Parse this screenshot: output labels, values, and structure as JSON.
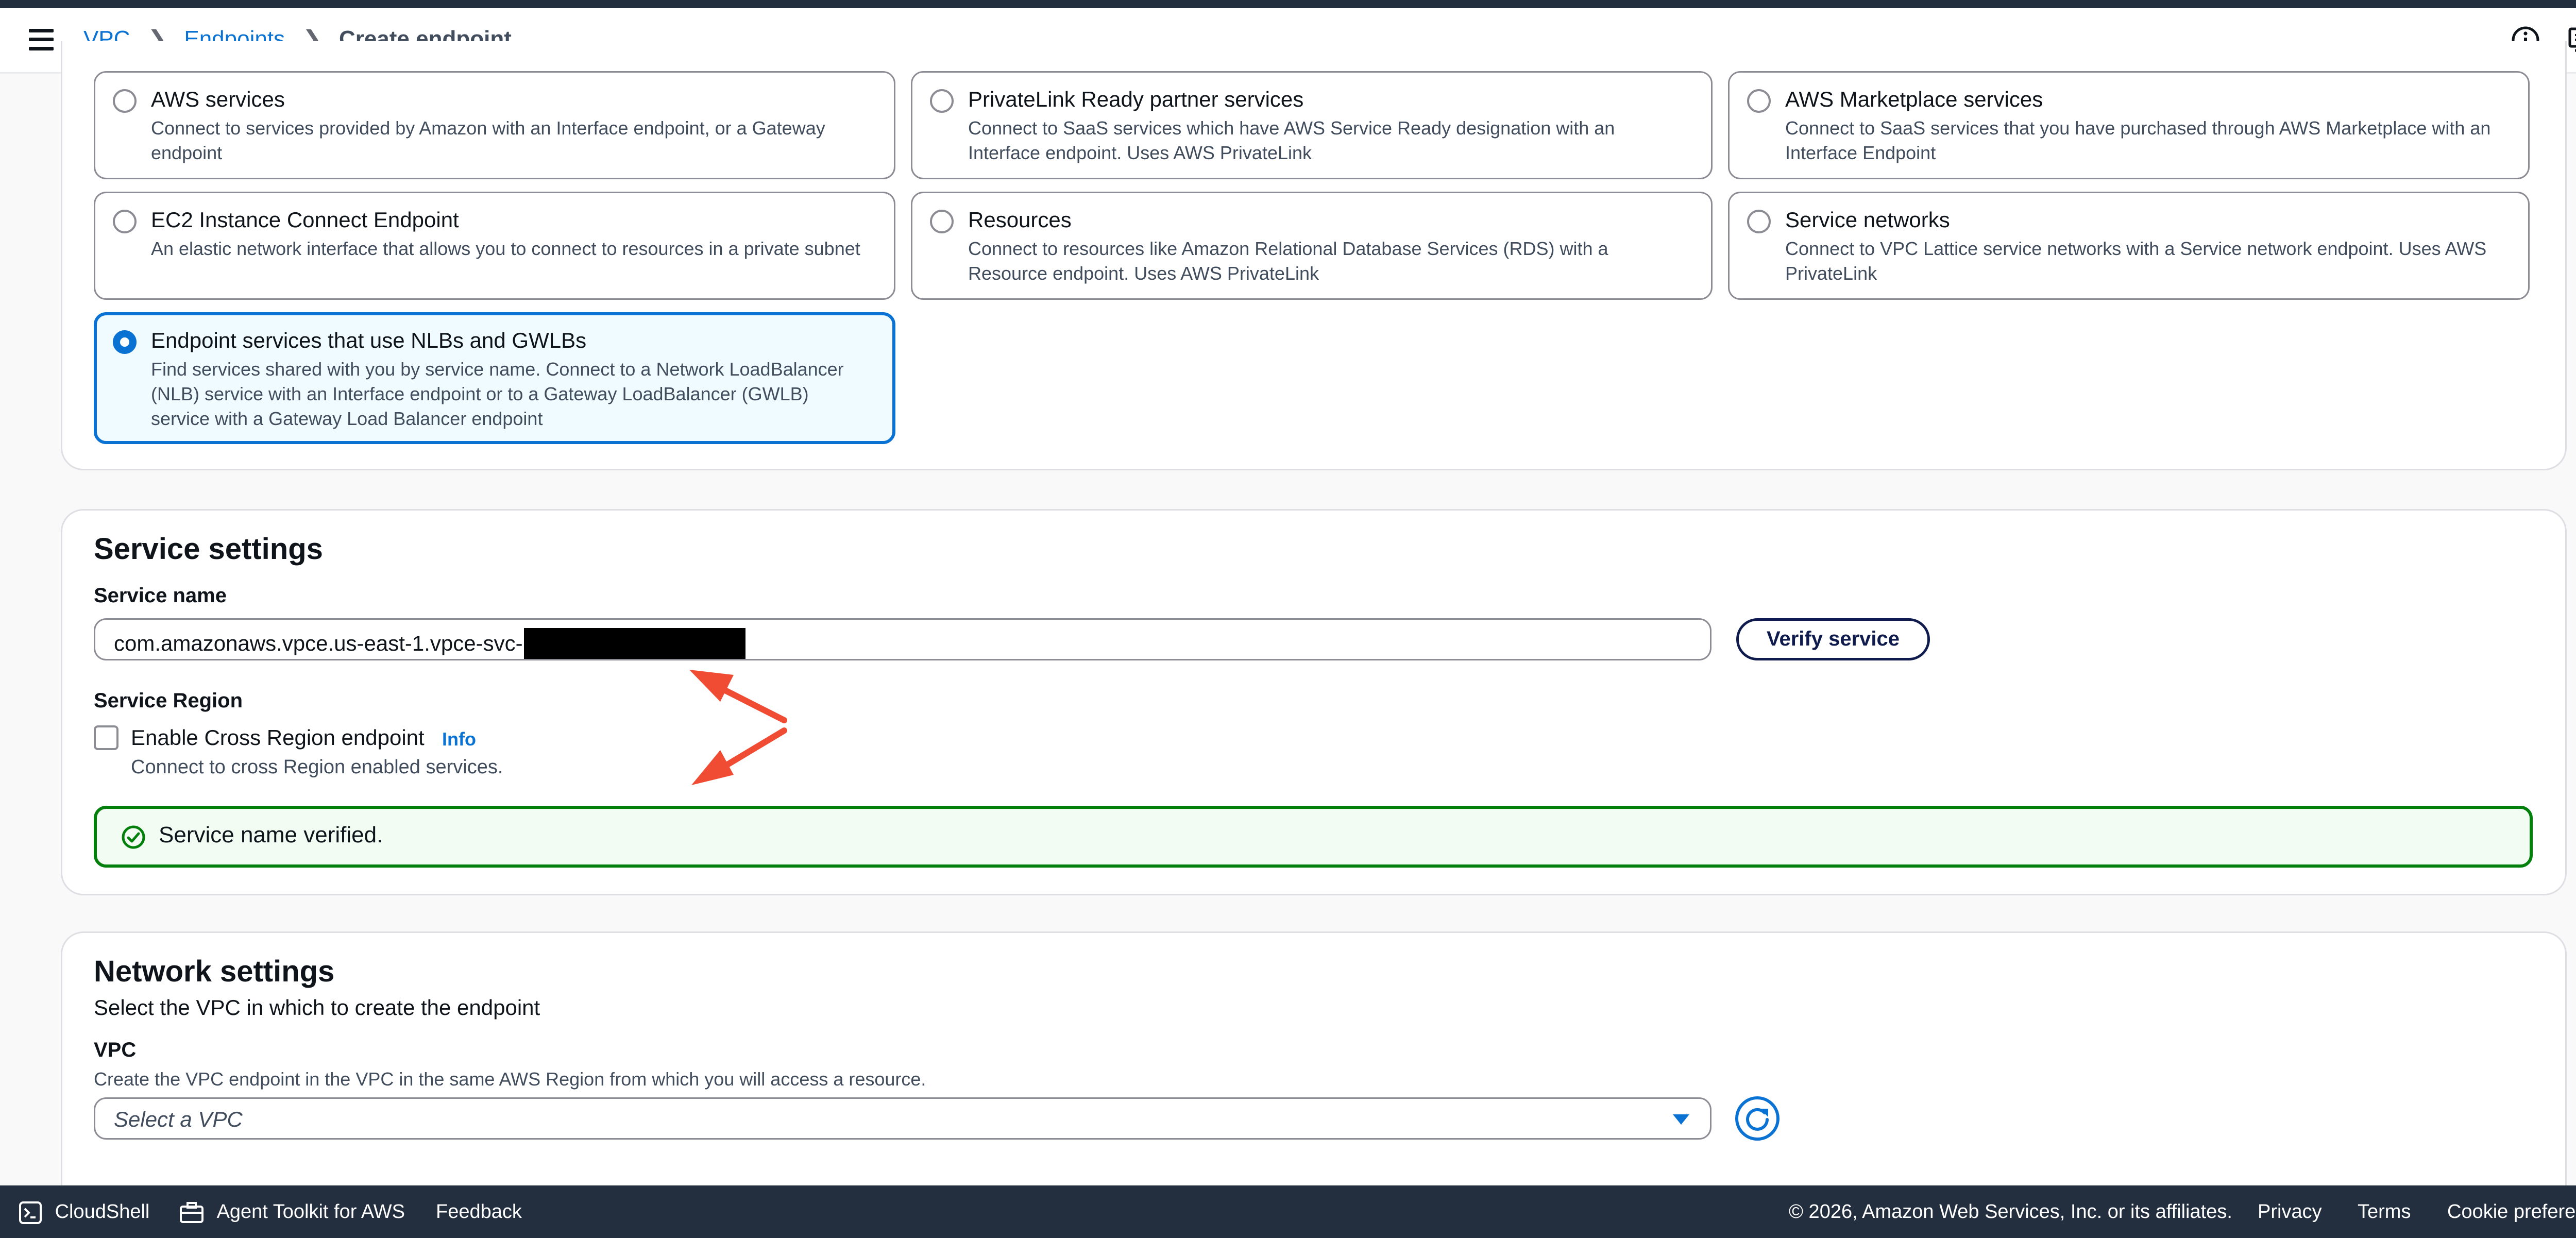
{
  "breadcrumb": {
    "vpc": "VPC",
    "endpoints": "Endpoints",
    "current": "Create endpoint"
  },
  "service_category": {
    "options": [
      {
        "title": "AWS services",
        "desc": "Connect to services provided by Amazon with an Interface endpoint, or a Gateway endpoint",
        "selected": false
      },
      {
        "title": "PrivateLink Ready partner services",
        "desc": "Connect to SaaS services which have AWS Service Ready designation with an Interface endpoint. Uses AWS PrivateLink",
        "selected": false
      },
      {
        "title": "AWS Marketplace services",
        "desc": "Connect to SaaS services that you have purchased through AWS Marketplace with an Interface Endpoint",
        "selected": false
      },
      {
        "title": "EC2 Instance Connect Endpoint",
        "desc": "An elastic network interface that allows you to connect to resources in a private subnet",
        "selected": false
      },
      {
        "title": "Resources",
        "desc": "Connect to resources like Amazon Relational Database Services (RDS) with a Resource endpoint. Uses AWS PrivateLink",
        "selected": false
      },
      {
        "title": "Service networks",
        "desc": "Connect to VPC Lattice service networks with a Service network endpoint. Uses AWS PrivateLink",
        "selected": false
      },
      {
        "title": "Endpoint services that use NLBs and GWLBs",
        "desc": "Find services shared with you by service name. Connect to a Network LoadBalancer (NLB) service with an Interface endpoint or to a Gateway LoadBalancer (GWLB) service with a Gateway Load Balancer endpoint",
        "selected": true
      }
    ]
  },
  "service_settings": {
    "heading": "Service settings",
    "service_name_label": "Service name",
    "service_name_value": "com.amazonaws.vpce.us-east-1.vpce-svc-",
    "verify_button": "Verify service",
    "region_label": "Service Region",
    "cross_region_label": "Enable Cross Region endpoint",
    "cross_region_checked": false,
    "info_link": "Info",
    "cross_region_desc": "Connect to cross Region enabled services.",
    "verified_message": "Service name verified."
  },
  "network_settings": {
    "heading": "Network settings",
    "subheading": "Select the VPC in which to create the endpoint",
    "vpc_label": "VPC",
    "vpc_desc": "Create the VPC endpoint in the VPC in the same AWS Region from which you will access a resource.",
    "vpc_placeholder": "Select a VPC"
  },
  "footer": {
    "cloudshell": "CloudShell",
    "agent_toolkit": "Agent Toolkit for AWS",
    "feedback": "Feedback",
    "copyright": "© 2026, Amazon Web Services, Inc. or its affiliates.",
    "privacy": "Privacy",
    "terms": "Terms",
    "cookies": "Cookie preferences"
  },
  "icons": {
    "menu": "hamburger-menu-icon",
    "info": "info-circle-icon",
    "notifications": "screen-notification-icon",
    "success": "check-circle-icon",
    "refresh": "refresh-icon",
    "caret": "caret-down-icon",
    "annotation": "red-arrow-annotation",
    "cloudshell": "terminal-icon",
    "agent_toolkit": "toolbox-icon"
  },
  "colors": {
    "accent": "#0972d3",
    "success": "#037f0c",
    "annotation": "#f04b33",
    "navbar": "#232f3e"
  }
}
